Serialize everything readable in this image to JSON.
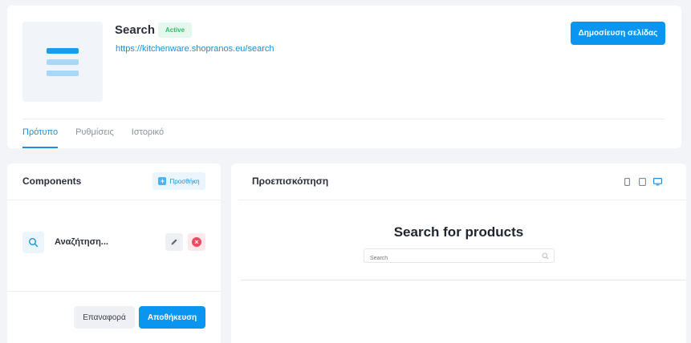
{
  "header": {
    "title": "Search",
    "status": "Active",
    "url": "https://kitchenware.shopranos.eu/search",
    "publish_label": "Δημοσίευση σελίδας",
    "tabs": [
      {
        "label": "Πρότυπο",
        "active": true
      },
      {
        "label": "Ρυθμίσεις",
        "active": false
      },
      {
        "label": "Ιστορικό",
        "active": false
      }
    ]
  },
  "components": {
    "title": "Components",
    "add_label": "Προσθήκη",
    "items": [
      {
        "label": "Αναζήτηση...",
        "icon": "search-icon"
      }
    ],
    "reset_label": "Επαναφορά",
    "save_label": "Αποθήκευση"
  },
  "preview": {
    "title": "Προεπισκόπηση",
    "devices": [
      "mobile-icon",
      "tablet-icon",
      "desktop-icon"
    ],
    "active_device": "desktop",
    "heading": "Search for products",
    "search_placeholder": "Search"
  },
  "colors": {
    "accent": "#0a96f0",
    "success": "#2dbd6e",
    "danger": "#ee4a63"
  }
}
